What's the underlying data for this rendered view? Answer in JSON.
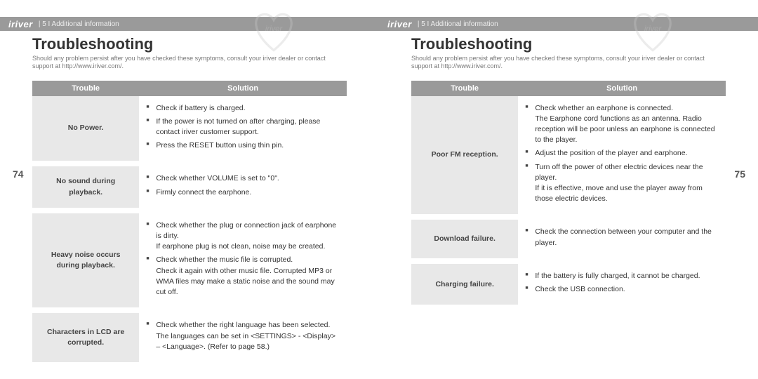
{
  "brand": "iriver",
  "section": " | 5 I Additional information",
  "heading": "Troubleshooting",
  "intro": "Should any problem persist after you have checked these symptoms, consult your iriver dealer or contact support at http://www.iriver.com/.",
  "table_headers": {
    "trouble": "Trouble",
    "solution": "Solution"
  },
  "pages": {
    "left": {
      "num": "74",
      "rows": [
        {
          "trouble": "No Power.",
          "items": [
            {
              "t": "Check if battery is charged."
            },
            {
              "t": "If the power is not turned on after charging, please contact iriver customer support."
            },
            {
              "t": "Press the RESET button using thin pin."
            }
          ]
        },
        {
          "trouble": "No sound during playback.",
          "items": [
            {
              "t": "Check whether VOLUME is set to \"0\"."
            },
            {
              "t": "Firmly connect the earphone."
            }
          ]
        },
        {
          "trouble": "Heavy noise occurs during playback.",
          "items": [
            {
              "t": "Check whether the plug or connection jack of earphone is dirty.",
              "s": "If earphone plug is not clean, noise may be created."
            },
            {
              "t": "Check whether the music file is corrupted.",
              "s": "Check it again with other music file. Corrupted MP3 or WMA files may make a static noise and the sound may cut off."
            }
          ]
        },
        {
          "trouble": "Characters in LCD are corrupted.",
          "items": [
            {
              "t": "Check whether the right language has been selected.",
              "s": "The languages can be set in <SETTINGS> - <Display> – <Language>. (Refer to page 58.)"
            }
          ]
        }
      ]
    },
    "right": {
      "num": "75",
      "rows": [
        {
          "trouble": "Poor FM reception.",
          "items": [
            {
              "t": "Check whether an earphone is connected.",
              "s": "The Earphone cord functions as an antenna. Radio reception will be poor unless an earphone is connected to the player."
            },
            {
              "t": "Adjust the position of the player and earphone."
            },
            {
              "t": "Turn off the power of other electric devices near the player.",
              "s": "If it is effective, move and use the player away from those electric devices."
            }
          ]
        },
        {
          "trouble": "Download failure.",
          "items": [
            {
              "t": "Check the connection between your computer and the player."
            }
          ]
        },
        {
          "trouble": "Charging failure.",
          "items": [
            {
              "t": "If the battery is fully charged, it cannot be charged."
            },
            {
              "t": "Check the USB connection."
            }
          ]
        }
      ]
    }
  }
}
